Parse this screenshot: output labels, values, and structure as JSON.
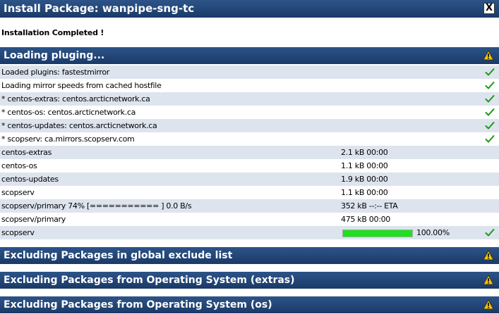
{
  "window": {
    "title": "Install Package: wanpipe-sng-tc",
    "close_glyph": "X"
  },
  "status": "Installation Completed !",
  "sections": [
    {
      "title": "Loading pluging...",
      "icon": "warning-icon"
    },
    {
      "title": "Excluding Packages in global exclude list",
      "icon": "warning-icon"
    },
    {
      "title": "Excluding Packages from Operating System (extras)",
      "icon": "warning-icon"
    },
    {
      "title": "Excluding Packages from Operating System (os)",
      "icon": "warning-icon"
    }
  ],
  "rows": [
    {
      "label": "Loaded plugins: fastestmirror",
      "info": "",
      "check": true
    },
    {
      "label": "Loading mirror speeds from cached hostfile",
      "info": "",
      "check": true
    },
    {
      "label": "* centos-extras: centos.arcticnetwork.ca",
      "info": "",
      "check": true
    },
    {
      "label": "* centos-os: centos.arcticnetwork.ca",
      "info": "",
      "check": true
    },
    {
      "label": "* centos-updates: centos.arcticnetwork.ca",
      "info": "",
      "check": true
    },
    {
      "label": "* scopserv: ca.mirrors.scopserv.com",
      "info": "",
      "check": true
    },
    {
      "label": "centos-extras",
      "info": "2.1 kB 00:00",
      "check": false
    },
    {
      "label": "centos-os",
      "info": "1.1 kB 00:00",
      "check": false
    },
    {
      "label": "centos-updates",
      "info": "1.9 kB 00:00",
      "check": false
    },
    {
      "label": "scopserv",
      "info": "1.1 kB 00:00",
      "check": false
    },
    {
      "label": "scopserv/primary 74% [=========== ] 0.0 B/s",
      "info": "352 kB --:-- ETA",
      "check": false
    },
    {
      "label": "scopserv/primary",
      "info": "475 kB 00:00",
      "check": false
    },
    {
      "label": "scopserv",
      "info": "",
      "check": true,
      "progress": 1.0,
      "progress_text": "100.00%"
    }
  ],
  "colors": {
    "header": "#1f4273",
    "alt_row": "#dde4ee",
    "progress": "#1fe01f",
    "check": "#1a9a1a",
    "warning": "#f5c400"
  }
}
